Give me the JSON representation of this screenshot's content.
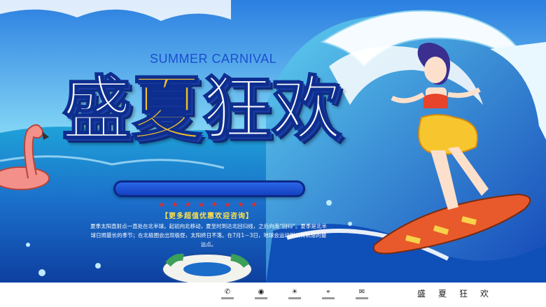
{
  "subtitle": "SUMMER CARNIVAL",
  "title_chars": [
    "盛",
    "夏",
    "狂",
    "欢"
  ],
  "promo": "【更多超值优惠欢迎咨询】",
  "description": "夏季太阳直射点一直处在北半球。起初向北移动，夏至时到达北回归线，之后向南“回归”。夏季是北半球日照最长的季节；在北极圈会出现极昼，太阳终日不落。在7月1－3日，地球会运动到公转轨道的最远点。",
  "footer_brand": [
    "盛",
    "夏",
    "狂",
    "欢"
  ],
  "footer_icons": [
    "phone-icon",
    "wifi-icon",
    "sun-icon",
    "location-icon",
    "mail-icon"
  ],
  "colors": {
    "accent": "#1b4fd0",
    "gold": "#f4c02a",
    "wave": "#1e6fd6"
  }
}
